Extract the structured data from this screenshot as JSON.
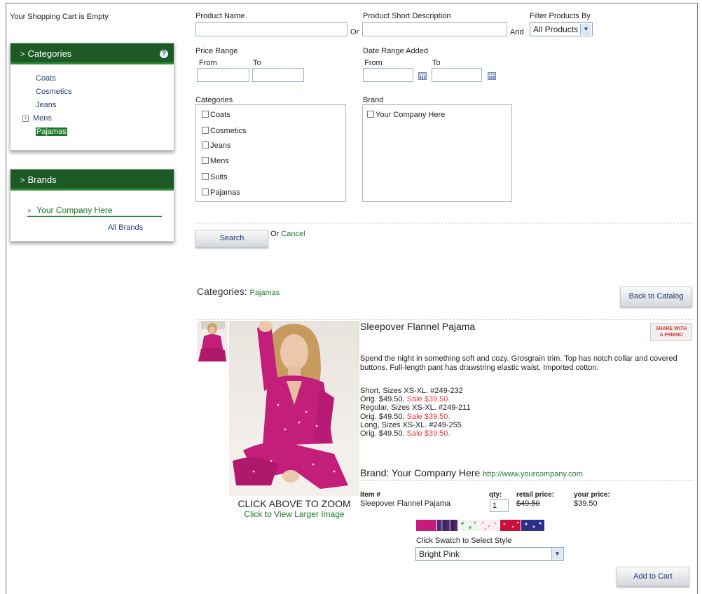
{
  "cart_status": "Your Shopping Cart is Empty",
  "categories_panel": {
    "title": "Categories",
    "items": [
      "Coats",
      "Cosmetics",
      "Jeans",
      "Mens",
      "Pajamas"
    ],
    "expander": "+"
  },
  "brands_panel": {
    "title": "Brands",
    "items": [
      "Your Company Here"
    ],
    "all_link": "All Brands"
  },
  "search_form": {
    "product_name_label": "Product Name",
    "or_label": "Or",
    "short_desc_label": "Product Short Description",
    "and_label": "And",
    "filter_label": "Filter Products By",
    "filter_value": "All Products",
    "price_range_label": "Price Range",
    "price_from": "From",
    "price_to": "To",
    "date_range_label": "Date Range Added",
    "date_from": "From",
    "date_to": "To",
    "categories_label": "Categories",
    "category_options": [
      "Coats",
      "Cosmetics",
      "Jeans",
      "Mens",
      "Suits",
      "Pajamas"
    ],
    "brand_label": "Brand",
    "brand_options": [
      "Your Company Here"
    ],
    "search_button": "Search",
    "or_cancel_prefix": "Or",
    "cancel_link": "Cancel"
  },
  "breadcrumb": {
    "label": "Categories:",
    "current": "Pajamas"
  },
  "back_button": "Back to Catalog",
  "product": {
    "title": "Sleepover Flannel Pajama",
    "share_line1": "SHARE WITH",
    "share_line2": "A FRIEND",
    "description": "Spend the night in something soft and cozy. Grosgrain trim. Top has notch collar and covered buttons. Full-length pant has drawstring elastic waist. Imported cotton.",
    "variants": [
      {
        "name": "Short, Sizes XS-XL. #249-232",
        "orig": "Orig. $49.50.",
        "sale": "Sale $39.50."
      },
      {
        "name": "Regular, Sizes XS-XL. #249-211",
        "orig": "Orig. $49.50.",
        "sale": "Sale $39.50."
      },
      {
        "name": "Long, Sizes XS-XL. #249-255",
        "orig": "Orig. $49.50.",
        "sale": "Sale $39.50."
      }
    ],
    "zoom_text": "CLICK ABOVE TO ZOOM",
    "larger_link": "Click to View Larger Image",
    "brand_label": "Brand: Your Company Here",
    "brand_url": "http://www.yourcompany.com",
    "item_header": "item #",
    "item_name": "Sleepover Flannel Pajama",
    "qty_header": "qty:",
    "qty_value": "1",
    "retail_header": "retail price:",
    "retail_value": "$49.50",
    "your_header": "your price:",
    "your_value": "$39.50",
    "swatch_label": "Click Swatch to Select Style",
    "style_value": "Bright Pink",
    "add_button": "Add to Cart"
  },
  "colors": {
    "accent_green": "#1e5a25",
    "link_green": "#1d7a2c",
    "sale_red": "#e03a3a",
    "product_pink": "#c21e7a"
  }
}
